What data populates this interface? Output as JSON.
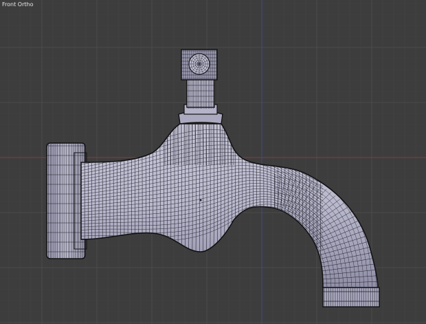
{
  "viewport": {
    "view_label": "Front Ortho",
    "object": "faucet-mesh",
    "colors": {
      "background": "#3d3d3d",
      "grid_minor": "#474747",
      "grid_major": "#525252",
      "axis_x": "#8a3a3a",
      "axis_z": "#3a4a8a",
      "mesh_fill": "#b9b8cc",
      "mesh_shade": "#8f8ea6",
      "wire": "#1a1a1a"
    }
  }
}
